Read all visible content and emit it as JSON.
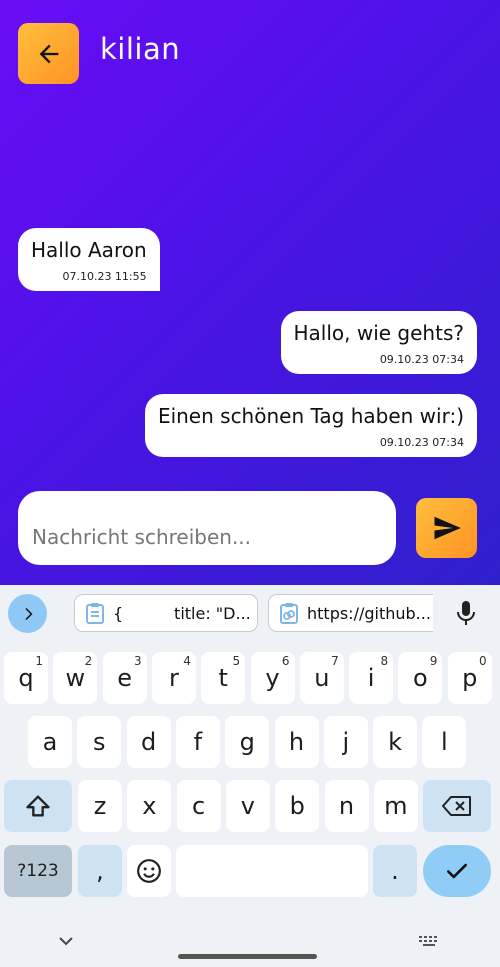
{
  "header": {
    "title": "kilian",
    "back_icon": "arrow-left-icon"
  },
  "messages": [
    {
      "text": "Hallo Aaron",
      "time": "07.10.23 11:55",
      "direction": "incoming"
    },
    {
      "text": "Hallo, wie gehts?",
      "time": "09.10.23 07:34",
      "direction": "outgoing"
    },
    {
      "text": "Einen schönen Tag haben wir:)",
      "time": "09.10.23 07:34",
      "direction": "outgoing"
    }
  ],
  "composer": {
    "placeholder": "Nachricht schreiben...",
    "send_icon": "send-icon"
  },
  "keyboard": {
    "suggestions": [
      {
        "text": "{          title: \"D...",
        "icon": "clipboard-icon"
      },
      {
        "text": "https://github...",
        "icon": "clipboard-link-icon"
      }
    ],
    "row1": [
      {
        "k": "q",
        "s": "1"
      },
      {
        "k": "w",
        "s": "2"
      },
      {
        "k": "e",
        "s": "3"
      },
      {
        "k": "r",
        "s": "4"
      },
      {
        "k": "t",
        "s": "5"
      },
      {
        "k": "y",
        "s": "6"
      },
      {
        "k": "u",
        "s": "7"
      },
      {
        "k": "i",
        "s": "8"
      },
      {
        "k": "o",
        "s": "9"
      },
      {
        "k": "p",
        "s": "0"
      }
    ],
    "row2": [
      "a",
      "s",
      "d",
      "f",
      "g",
      "h",
      "j",
      "k",
      "l"
    ],
    "row3": [
      "z",
      "x",
      "c",
      "v",
      "b",
      "n",
      "m"
    ],
    "symbols_label": "?123",
    "comma": ",",
    "period": "."
  },
  "colors": {
    "accent_orange": "#ff9f2a",
    "gradient_start": "#6a0cf6",
    "gradient_end": "#2f20cc",
    "key_accent": "#8fcdf6"
  }
}
